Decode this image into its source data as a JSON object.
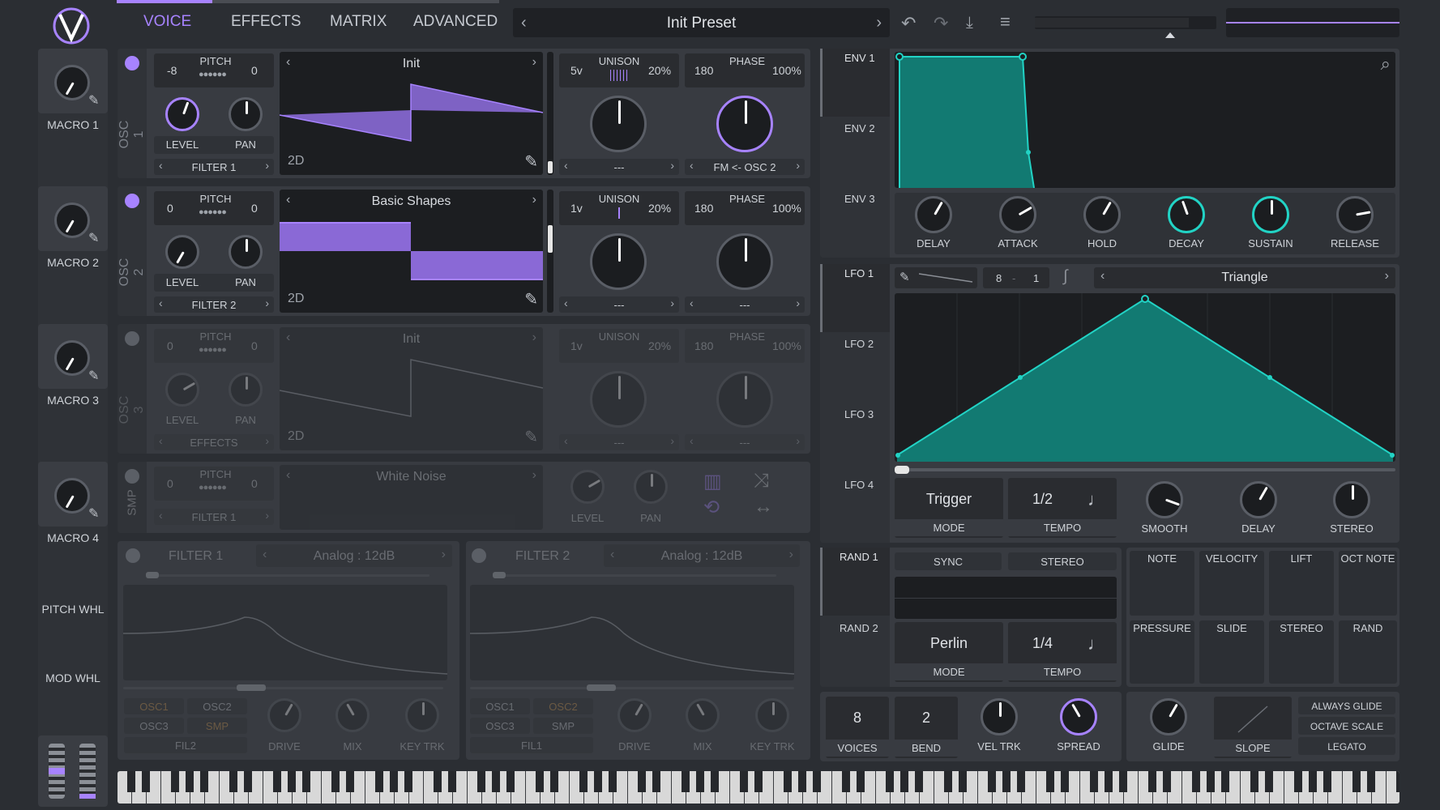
{
  "tabs": [
    "VOICE",
    "EFFECTS",
    "MATRIX",
    "ADVANCED"
  ],
  "preset": "Init Preset",
  "macros": [
    "MACRO 1",
    "MACRO 2",
    "MACRO 3",
    "MACRO 4",
    "PITCH WHL",
    "MOD WHL"
  ],
  "osc": [
    {
      "label": "OSC 1",
      "pitch_l": "-8",
      "pitch": "PITCH",
      "pitch_r": "0",
      "wave": "Init",
      "mode": "2D",
      "voices": "5v",
      "unison": "UNISON",
      "unison_pct": "20%",
      "phase_val": "180",
      "phase": "PHASE",
      "phase_pct": "100%",
      "level": "LEVEL",
      "pan": "PAN",
      "route": "FILTER 1",
      "dest1": "---",
      "dest2": "FM <- OSC 2"
    },
    {
      "label": "OSC 2",
      "pitch_l": "0",
      "pitch": "PITCH",
      "pitch_r": "0",
      "wave": "Basic Shapes",
      "mode": "2D",
      "voices": "1v",
      "unison": "UNISON",
      "unison_pct": "20%",
      "phase_val": "180",
      "phase": "PHASE",
      "phase_pct": "100%",
      "level": "LEVEL",
      "pan": "PAN",
      "route": "FILTER 2",
      "dest1": "---",
      "dest2": "---"
    },
    {
      "label": "OSC 3",
      "pitch_l": "0",
      "pitch": "PITCH",
      "pitch_r": "0",
      "wave": "Init",
      "mode": "2D",
      "voices": "1v",
      "unison": "UNISON",
      "unison_pct": "20%",
      "phase_val": "180",
      "phase": "PHASE",
      "phase_pct": "100%",
      "level": "LEVEL",
      "pan": "PAN",
      "route": "EFFECTS",
      "dest1": "---",
      "dest2": "---"
    }
  ],
  "smp": {
    "label": "SMP",
    "pitch_l": "0",
    "pitch": "PITCH",
    "pitch_r": "0",
    "wave": "White Noise",
    "route": "FILTER 1",
    "level": "LEVEL",
    "pan": "PAN"
  },
  "filters": [
    {
      "title": "FILTER 1",
      "type": "Analog : 12dB",
      "src": [
        "OSC1",
        "OSC2",
        "OSC3",
        "SMP"
      ],
      "extra": "FIL2",
      "drive": "DRIVE",
      "mix": "MIX",
      "keytrk": "KEY TRK"
    },
    {
      "title": "FILTER 2",
      "type": "Analog : 12dB",
      "src": [
        "OSC1",
        "OSC2",
        "OSC3",
        "SMP"
      ],
      "extra": "FIL1",
      "drive": "DRIVE",
      "mix": "MIX",
      "keytrk": "KEY TRK"
    }
  ],
  "env_tabs": [
    "ENV 1",
    "ENV 2",
    "ENV 3"
  ],
  "env_knobs": [
    "DELAY",
    "ATTACK",
    "HOLD",
    "DECAY",
    "SUSTAIN",
    "RELEASE"
  ],
  "lfo_tabs": [
    "LFO 1",
    "LFO 2",
    "LFO 3",
    "LFO 4"
  ],
  "lfo": {
    "grid_x": "8",
    "grid_y": "1",
    "shape": "Triangle",
    "mode_val": "Trigger",
    "mode": "MODE",
    "tempo_val": "1/2",
    "tempo": "TEMPO",
    "smooth": "SMOOTH",
    "delay": "DELAY",
    "stereo": "STEREO"
  },
  "rand_tabs": [
    "RAND 1",
    "RAND 2"
  ],
  "rand": {
    "sync": "SYNC",
    "stereo": "STEREO",
    "mode_val": "Perlin",
    "mode": "MODE",
    "tempo_val": "1/4",
    "tempo": "TEMPO"
  },
  "mod_sources": [
    "NOTE",
    "VELOCITY",
    "LIFT",
    "OCT NOTE",
    "PRESSURE",
    "SLIDE",
    "STEREO",
    "RAND"
  ],
  "voice": {
    "voices_val": "8",
    "voices": "VOICES",
    "bend_val": "2",
    "bend": "BEND",
    "veltrk": "VEL TRK",
    "spread": "SPREAD",
    "glide": "GLIDE",
    "slope": "SLOPE"
  },
  "glide_opts": [
    "ALWAYS GLIDE",
    "OCTAVE SCALE",
    "LEGATO"
  ],
  "colors": {
    "accent": "#a783ff",
    "teal": "#22d3c5",
    "panel": "#383b41",
    "bg": "#2b2e33"
  }
}
